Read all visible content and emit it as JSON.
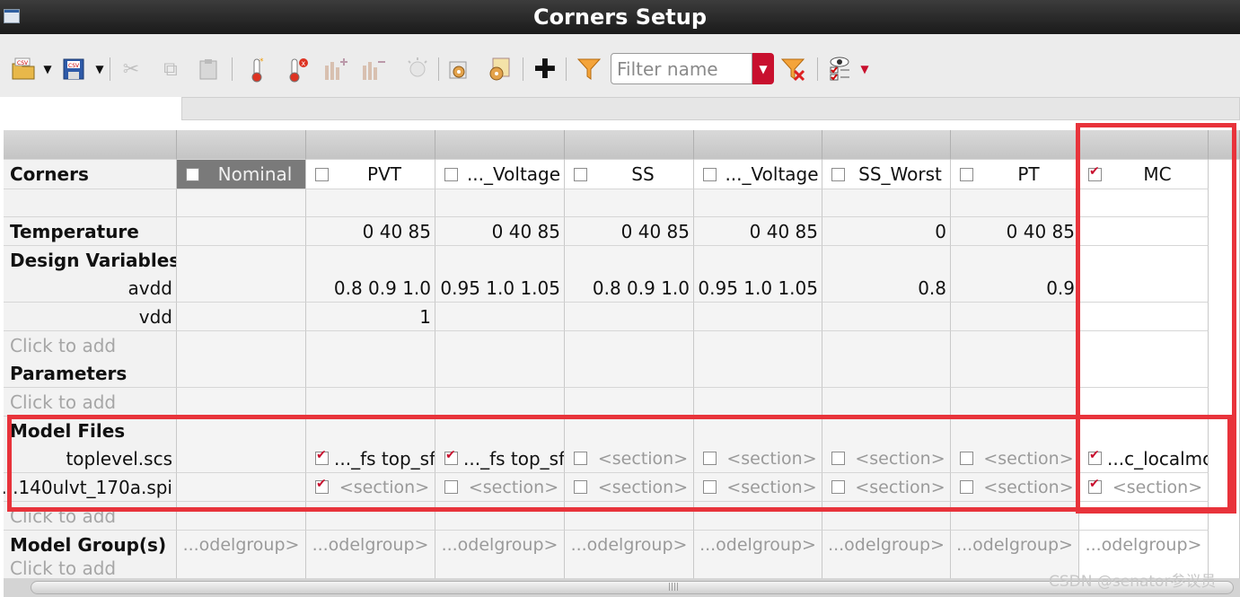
{
  "window": {
    "title": "Corners Setup"
  },
  "toolbar": {
    "filter_placeholder": "Filter name",
    "icons": [
      "open-csv-icon",
      "save-csv-icon",
      "cut-icon",
      "copy-icon",
      "paste-icon",
      "add-temperature-icon",
      "remove-temperature-icon",
      "add-variable-icon",
      "remove-variable-icon",
      "lightbulb-icon",
      "load-setup-icon",
      "save-setup-icon",
      "add-corner-icon",
      "filter-icon",
      "filter-dropdown-icon",
      "clear-filter-icon",
      "view-options-icon"
    ]
  },
  "grid": {
    "corner_label": "Corners",
    "columns": [
      {
        "label": "Nominal",
        "checked": false
      },
      {
        "label": "PVT",
        "checked": false
      },
      {
        "label": "..._Voltage",
        "checked": false
      },
      {
        "label": "SS",
        "checked": false
      },
      {
        "label": "..._Voltage",
        "checked": false
      },
      {
        "label": "SS_Worst",
        "checked": false
      },
      {
        "label": "PT",
        "checked": false
      },
      {
        "label": "MC",
        "checked": true
      }
    ],
    "sections": {
      "temperature": "Temperature",
      "design_variables": "Design Variables",
      "parameters": "Parameters",
      "model_files": "Model Files",
      "model_groups": "Model Group(s)"
    },
    "click_to_add": "Click to add",
    "temperature_values": [
      "",
      "0 40 85",
      "0 40 85",
      "0 40 85",
      "0 40 85",
      "0",
      "0 40 85",
      ""
    ],
    "variables": [
      {
        "name": "avdd",
        "values": [
          "",
          "0.8 0.9 1.0",
          "0.95 1.0 1.05",
          "0.8 0.9 1.0",
          "0.95 1.0 1.05",
          "0.8",
          "0.9",
          ""
        ]
      },
      {
        "name": "vdd",
        "values": [
          "",
          "1",
          "",
          "",
          "",
          "",
          "",
          ""
        ]
      }
    ],
    "model_files": [
      {
        "name": "toplevel.scs",
        "cells": [
          {
            "checked": null,
            "text": ""
          },
          {
            "checked": true,
            "text": "..._fs top_sf"
          },
          {
            "checked": true,
            "text": "..._fs top_sf"
          },
          {
            "checked": false,
            "text": "<section>"
          },
          {
            "checked": false,
            "text": "<section>"
          },
          {
            "checked": false,
            "text": "<section>"
          },
          {
            "checked": false,
            "text": "<section>"
          },
          {
            "checked": true,
            "text": "...c_localmc"
          }
        ]
      },
      {
        "name": "...140ulvt_170a.spi",
        "cells": [
          {
            "checked": null,
            "text": ""
          },
          {
            "checked": true,
            "text": "<section>"
          },
          {
            "checked": false,
            "text": "<section>"
          },
          {
            "checked": false,
            "text": "<section>"
          },
          {
            "checked": false,
            "text": "<section>"
          },
          {
            "checked": false,
            "text": "<section>"
          },
          {
            "checked": false,
            "text": "<section>"
          },
          {
            "checked": true,
            "text": "<section>"
          }
        ]
      }
    ],
    "model_group_value": "...odelgroup>"
  },
  "watermark": "CSDN @senator参议员",
  "highlight_color": "#e8333b"
}
